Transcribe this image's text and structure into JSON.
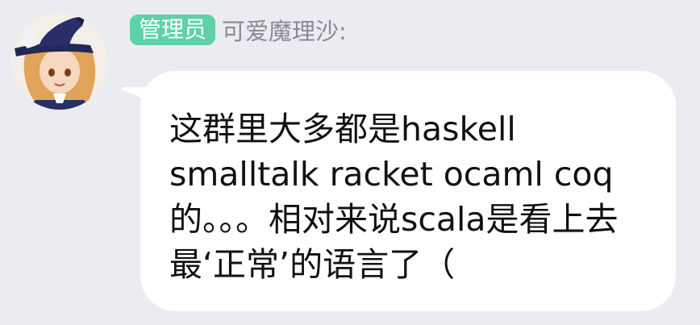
{
  "message": {
    "badge": "管理员",
    "sender": "可爱魔理沙:",
    "text": "这群里大多都是haskell smalltalk racket ocaml coq 的。。。相对来说scala是看上去最‘正常’的语言了（"
  },
  "colors": {
    "background": "#ebecf1",
    "badge": "#5fd1a6",
    "bubble": "#ffffff",
    "sender_text": "#888a92",
    "message_text": "#111111"
  },
  "icons": {
    "avatar": "avatar-icon",
    "bubble_tail": "bubble-tail-icon"
  }
}
